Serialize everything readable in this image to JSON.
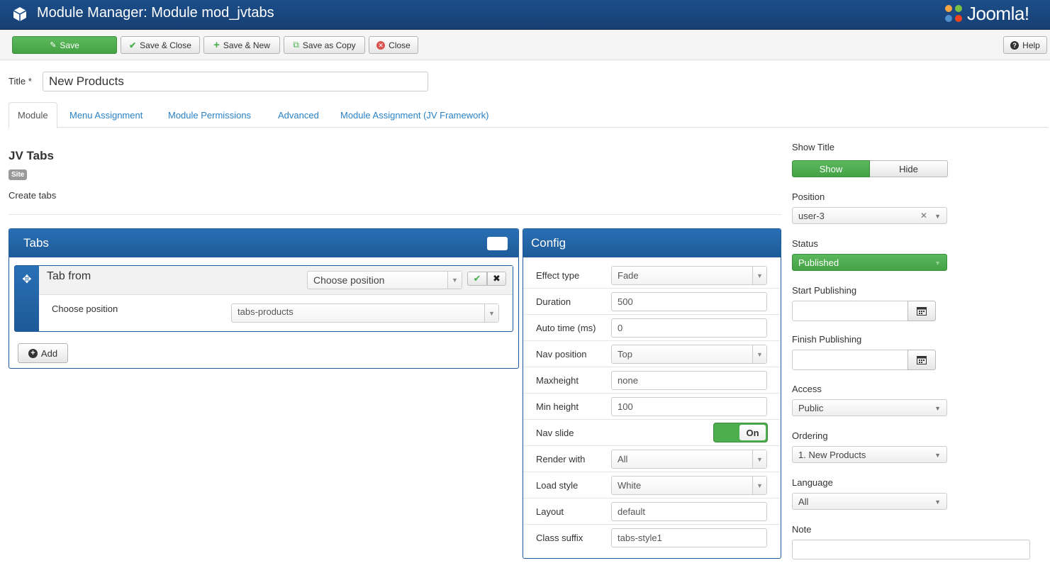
{
  "header": {
    "title": "Module Manager: Module mod_jvtabs",
    "logo_text": "Joomla!"
  },
  "toolbar": {
    "save": "Save",
    "save_close": "Save & Close",
    "save_new": "Save & New",
    "save_copy": "Save as Copy",
    "close": "Close",
    "help": "Help"
  },
  "title_field": {
    "label": "Title *",
    "value": "New Products"
  },
  "tabs": [
    "Module",
    "Menu Assignment",
    "Module Permissions",
    "Advanced",
    "Module Assignment (JV Framework)"
  ],
  "module": {
    "name": "JV Tabs",
    "badge": "Site",
    "description": "Create tabs"
  },
  "tabs_panel": {
    "heading": "Tabs",
    "item_title": "Tab from",
    "item_select": "Choose position",
    "row_label": "Choose position",
    "row_value": "tabs-products",
    "add_label": "Add"
  },
  "config": {
    "heading": "Config",
    "rows": [
      {
        "label": "Effect type",
        "value": "Fade"
      },
      {
        "label": "Duration",
        "value": "500"
      },
      {
        "label": "Auto time (ms)",
        "value": "0"
      },
      {
        "label": "Nav position",
        "value": "Top"
      },
      {
        "label": "Maxheight",
        "value": "none"
      },
      {
        "label": "Min height",
        "value": "100"
      },
      {
        "label": "Nav slide",
        "value": "On"
      },
      {
        "label": "Render with",
        "value": "All"
      },
      {
        "label": "Load style",
        "value": "White"
      },
      {
        "label": "Layout",
        "value": "default"
      },
      {
        "label": "Class suffix",
        "value": "tabs-style1"
      }
    ]
  },
  "sidebar": {
    "show_title_label": "Show Title",
    "show": "Show",
    "hide": "Hide",
    "position_label": "Position",
    "position_value": "user-3",
    "status_label": "Status",
    "status_value": "Published",
    "start_label": "Start Publishing",
    "finish_label": "Finish Publishing",
    "access_label": "Access",
    "access_value": "Public",
    "ordering_label": "Ordering",
    "ordering_value": "1. New Products",
    "language_label": "Language",
    "language_value": "All",
    "note_label": "Note"
  },
  "colors": {
    "header": "#1c4e8a",
    "accent_green": "#4cae4c",
    "link": "#2a81c4"
  }
}
